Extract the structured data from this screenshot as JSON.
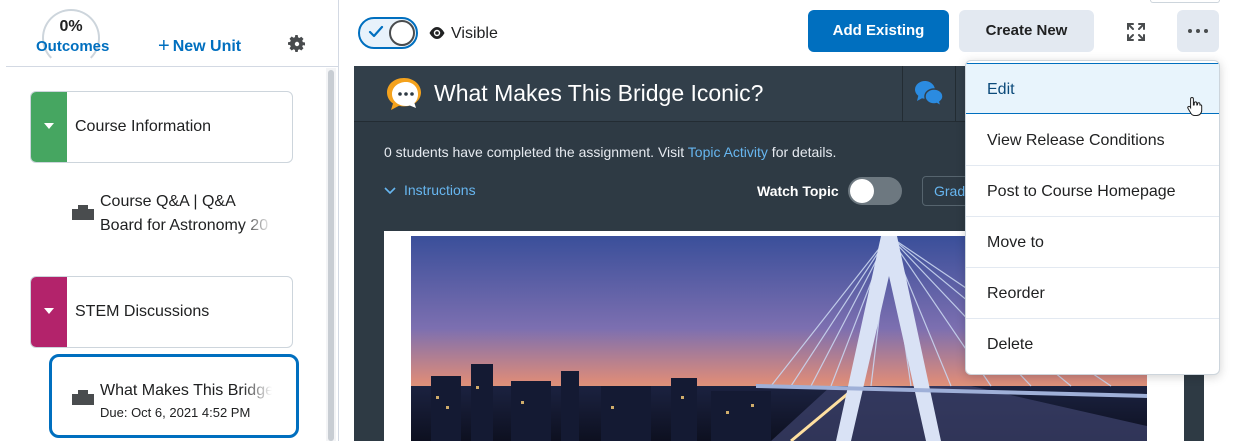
{
  "sidebar": {
    "outcomes": {
      "percent": "0%",
      "label": "Outcomes"
    },
    "new_unit_label": "New Unit",
    "settings_icon": "gear-icon",
    "units": [
      {
        "label": "Course Information",
        "color": "#46a661"
      },
      {
        "label": "STEM Discussions",
        "color": "#b3236b"
      }
    ],
    "topics": [
      {
        "line1": "Course Q&A | Q&A",
        "line2": "Board for Astronomy 20",
        "icon": "discussion-icon"
      },
      {
        "line1": "What Makes This Bridge",
        "line2": "Due: Oct 6, 2021 4:52 PM",
        "icon": "discussion-icon",
        "selected": true
      }
    ]
  },
  "toolbar": {
    "visibility_label": "Visible",
    "add_existing_label": "Add Existing",
    "create_new_label": "Create New",
    "fullscreen_icon": "fullscreen-icon",
    "more_icon": "more-options-icon"
  },
  "panel": {
    "title": "What Makes This Bridge Iconic?",
    "info_prefix": "0 students have completed the assignment. Visit ",
    "info_link": "Topic Activity",
    "info_suffix": " for details.",
    "instructions_label": "Instructions",
    "watch_topic_label": "Watch Topic",
    "grade_label": "Grad"
  },
  "menu": {
    "items": [
      {
        "label": "Edit"
      },
      {
        "label": "View Release Conditions"
      },
      {
        "label": "Post to Course Homepage"
      },
      {
        "label": "Move to"
      },
      {
        "label": "Reorder"
      },
      {
        "label": "Delete"
      }
    ]
  },
  "colors": {
    "accent": "#006fbf",
    "panel_bg": "#2e3a44",
    "link_on_dark": "#67b6f0"
  }
}
